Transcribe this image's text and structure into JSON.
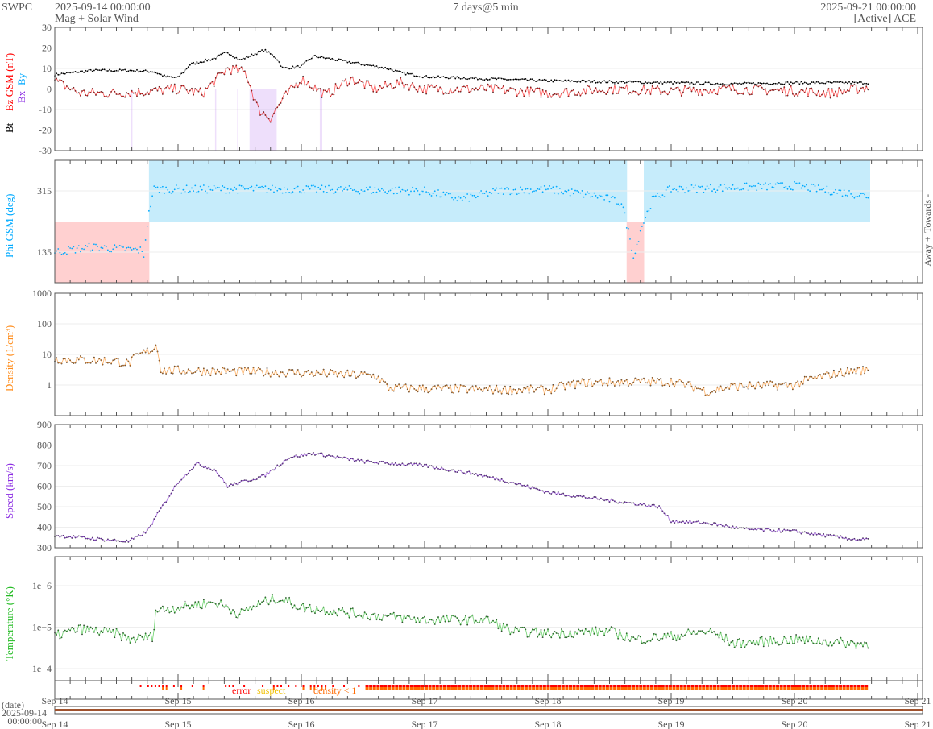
{
  "header": {
    "org": "SWPC",
    "start": "2025-09-14 00:00:00",
    "title": "Mag + Solar Wind",
    "span": "7 days@5 min",
    "end": "2025-09-21 00:00:00",
    "source": "[Active] ACE"
  },
  "colors": {
    "bt": "#000000",
    "bz": "#ff0000",
    "bx": "#8a2be2",
    "by": "#00aaff",
    "phi": "#00aaff",
    "density": "#ff8c1a",
    "speed": "#8a2be2",
    "temp": "#22bb22",
    "towards_bg": "#c6ecfb",
    "away_bg": "#ffd0d0",
    "error": "#ff0000",
    "suspect": "#f0c000",
    "dens_lt1": "#ff6a00"
  },
  "x_axis": {
    "labels": [
      "Sep 14",
      "Sep 15",
      "Sep 16",
      "Sep 17",
      "Sep 18",
      "Sep 19",
      "Sep 20",
      "Sep 21"
    ],
    "date_label": "(date)",
    "date_value": "2025-09-14",
    "time_value": "00:00:00"
  },
  "flags": {
    "error": "error",
    "suspect": "suspect",
    "density": "density < 1"
  },
  "chart_data": [
    {
      "type": "line",
      "name": "mag",
      "ylabel_bt": "Bt",
      "ylabel_bz": "Bz GSM (nT)",
      "ylabel_bx": "Bx",
      "ylabel_by": "By",
      "ylim": [
        -30,
        30
      ],
      "yticks": [
        "30",
        "20",
        "10",
        "0",
        "-10",
        "-20",
        "-30"
      ],
      "ytick_values": [
        30,
        20,
        10,
        0,
        -10,
        -20,
        -30
      ],
      "series": [
        {
          "name": "Bt",
          "points": [
            [
              0,
              7
            ],
            [
              0.3,
              9
            ],
            [
              0.6,
              9
            ],
            [
              0.8,
              8.5
            ],
            [
              0.9,
              6
            ],
            [
              1.0,
              5.5
            ],
            [
              1.1,
              12
            ],
            [
              1.3,
              15
            ],
            [
              1.4,
              18
            ],
            [
              1.5,
              14
            ],
            [
              1.7,
              19
            ],
            [
              1.8,
              15
            ],
            [
              1.85,
              10
            ],
            [
              2.0,
              11
            ],
            [
              2.1,
              16
            ],
            [
              2.5,
              12
            ],
            [
              2.7,
              10
            ],
            [
              2.8,
              8
            ],
            [
              3.0,
              6
            ],
            [
              3.5,
              5
            ],
            [
              4,
              4
            ],
            [
              4.5,
              3.5
            ],
            [
              5,
              3
            ],
            [
              5.5,
              2.5
            ],
            [
              6,
              3
            ],
            [
              6.6,
              3
            ]
          ]
        },
        {
          "name": "Bz",
          "points": [
            [
              0,
              4
            ],
            [
              0.2,
              -2
            ],
            [
              0.5,
              -2
            ],
            [
              0.8,
              -1
            ],
            [
              1.0,
              0
            ],
            [
              1.2,
              -2
            ],
            [
              1.4,
              10
            ],
            [
              1.55,
              8
            ],
            [
              1.65,
              -10
            ],
            [
              1.75,
              -14
            ],
            [
              1.85,
              -5
            ],
            [
              2.0,
              5
            ],
            [
              2.2,
              -3
            ],
            [
              2.4,
              5
            ],
            [
              2.6,
              0
            ],
            [
              2.8,
              3
            ],
            [
              3,
              0
            ],
            [
              3.5,
              0
            ],
            [
              4,
              -2
            ],
            [
              4.5,
              0
            ],
            [
              5,
              -1
            ],
            [
              5.5,
              0
            ],
            [
              6,
              -1
            ],
            [
              6.3,
              -2
            ],
            [
              6.6,
              1
            ]
          ]
        }
      ]
    },
    {
      "type": "scatter",
      "name": "phi",
      "ylabel": "Phi GSM (deg)",
      "ylim": [
        45,
        405
      ],
      "yticks": [
        "315",
        "135"
      ],
      "ytick_values": [
        315,
        135
      ],
      "right_labels": [
        "Towards -",
        "Away +"
      ],
      "points": [
        [
          0,
          135
        ],
        [
          0.3,
          150
        ],
        [
          0.7,
          140
        ],
        [
          0.72,
          120
        ],
        [
          0.75,
          220
        ],
        [
          0.8,
          320
        ],
        [
          1,
          320
        ],
        [
          2,
          320
        ],
        [
          3,
          315
        ],
        [
          3.3,
          290
        ],
        [
          3.6,
          315
        ],
        [
          4,
          320
        ],
        [
          4.4,
          300
        ],
        [
          4.6,
          280
        ],
        [
          4.7,
          120
        ],
        [
          4.75,
          200
        ],
        [
          4.85,
          290
        ],
        [
          5,
          320
        ],
        [
          5.5,
          325
        ],
        [
          6,
          330
        ],
        [
          6.6,
          300
        ]
      ]
    },
    {
      "type": "line",
      "name": "density",
      "ylabel": "Density (1/cm³)",
      "scale": "log",
      "ylim": [
        0.1,
        1000
      ],
      "yticks": [
        "1000",
        "100",
        "10",
        "1"
      ],
      "ytick_values": [
        1000,
        100,
        10,
        1
      ],
      "points": [
        [
          0,
          7
        ],
        [
          0.5,
          6
        ],
        [
          0.6,
          5
        ],
        [
          0.8,
          15
        ],
        [
          0.82,
          20
        ],
        [
          0.86,
          3
        ],
        [
          1,
          3
        ],
        [
          2,
          2.5
        ],
        [
          2.6,
          2
        ],
        [
          2.7,
          0.8
        ],
        [
          3.5,
          0.7
        ],
        [
          4,
          0.7
        ],
        [
          4.3,
          1.2
        ],
        [
          5,
          1.3
        ],
        [
          5.3,
          0.6
        ],
        [
          5.5,
          0.9
        ],
        [
          6,
          1
        ],
        [
          6.5,
          3
        ]
      ]
    },
    {
      "type": "line",
      "name": "speed",
      "ylabel": "Speed (km/s)",
      "ylim": [
        300,
        900
      ],
      "yticks": [
        "900",
        "800",
        "700",
        "600",
        "500",
        "400",
        "300"
      ],
      "ytick_values": [
        900,
        800,
        700,
        600,
        500,
        400,
        300
      ],
      "points": [
        [
          0,
          360
        ],
        [
          0.4,
          340
        ],
        [
          0.6,
          330
        ],
        [
          0.75,
          380
        ],
        [
          0.85,
          480
        ],
        [
          1.0,
          620
        ],
        [
          1.15,
          710
        ],
        [
          1.3,
          680
        ],
        [
          1.4,
          600
        ],
        [
          1.7,
          650
        ],
        [
          1.9,
          740
        ],
        [
          2.1,
          760
        ],
        [
          2.5,
          720
        ],
        [
          3,
          700
        ],
        [
          3.4,
          660
        ],
        [
          3.7,
          620
        ],
        [
          4,
          570
        ],
        [
          4.5,
          530
        ],
        [
          4.9,
          500
        ],
        [
          5.0,
          430
        ],
        [
          5.3,
          420
        ],
        [
          5.6,
          390
        ],
        [
          6,
          380
        ],
        [
          6.5,
          340
        ]
      ]
    },
    {
      "type": "line",
      "name": "temperature",
      "ylabel": "Temperature (°K)",
      "scale": "log",
      "ylim": [
        5128,
        5011872
      ],
      "yticks": [
        "1e+6",
        "1e+5",
        "1e+4"
      ],
      "ytick_values": [
        1000000,
        100000,
        10000
      ],
      "points": [
        [
          0,
          60000
        ],
        [
          0.2,
          90000
        ],
        [
          0.5,
          70000
        ],
        [
          0.6,
          50000
        ],
        [
          0.8,
          60000
        ],
        [
          0.82,
          250000
        ],
        [
          1,
          300000
        ],
        [
          1.3,
          400000
        ],
        [
          1.5,
          200000
        ],
        [
          1.8,
          500000
        ],
        [
          2.0,
          300000
        ],
        [
          2.5,
          200000
        ],
        [
          3,
          150000
        ],
        [
          3.5,
          150000
        ],
        [
          3.7,
          80000
        ],
        [
          4,
          70000
        ],
        [
          4.5,
          80000
        ],
        [
          4.7,
          50000
        ],
        [
          5,
          60000
        ],
        [
          5.3,
          80000
        ],
        [
          5.5,
          40000
        ],
        [
          6,
          50000
        ],
        [
          6.5,
          40000
        ]
      ]
    }
  ]
}
